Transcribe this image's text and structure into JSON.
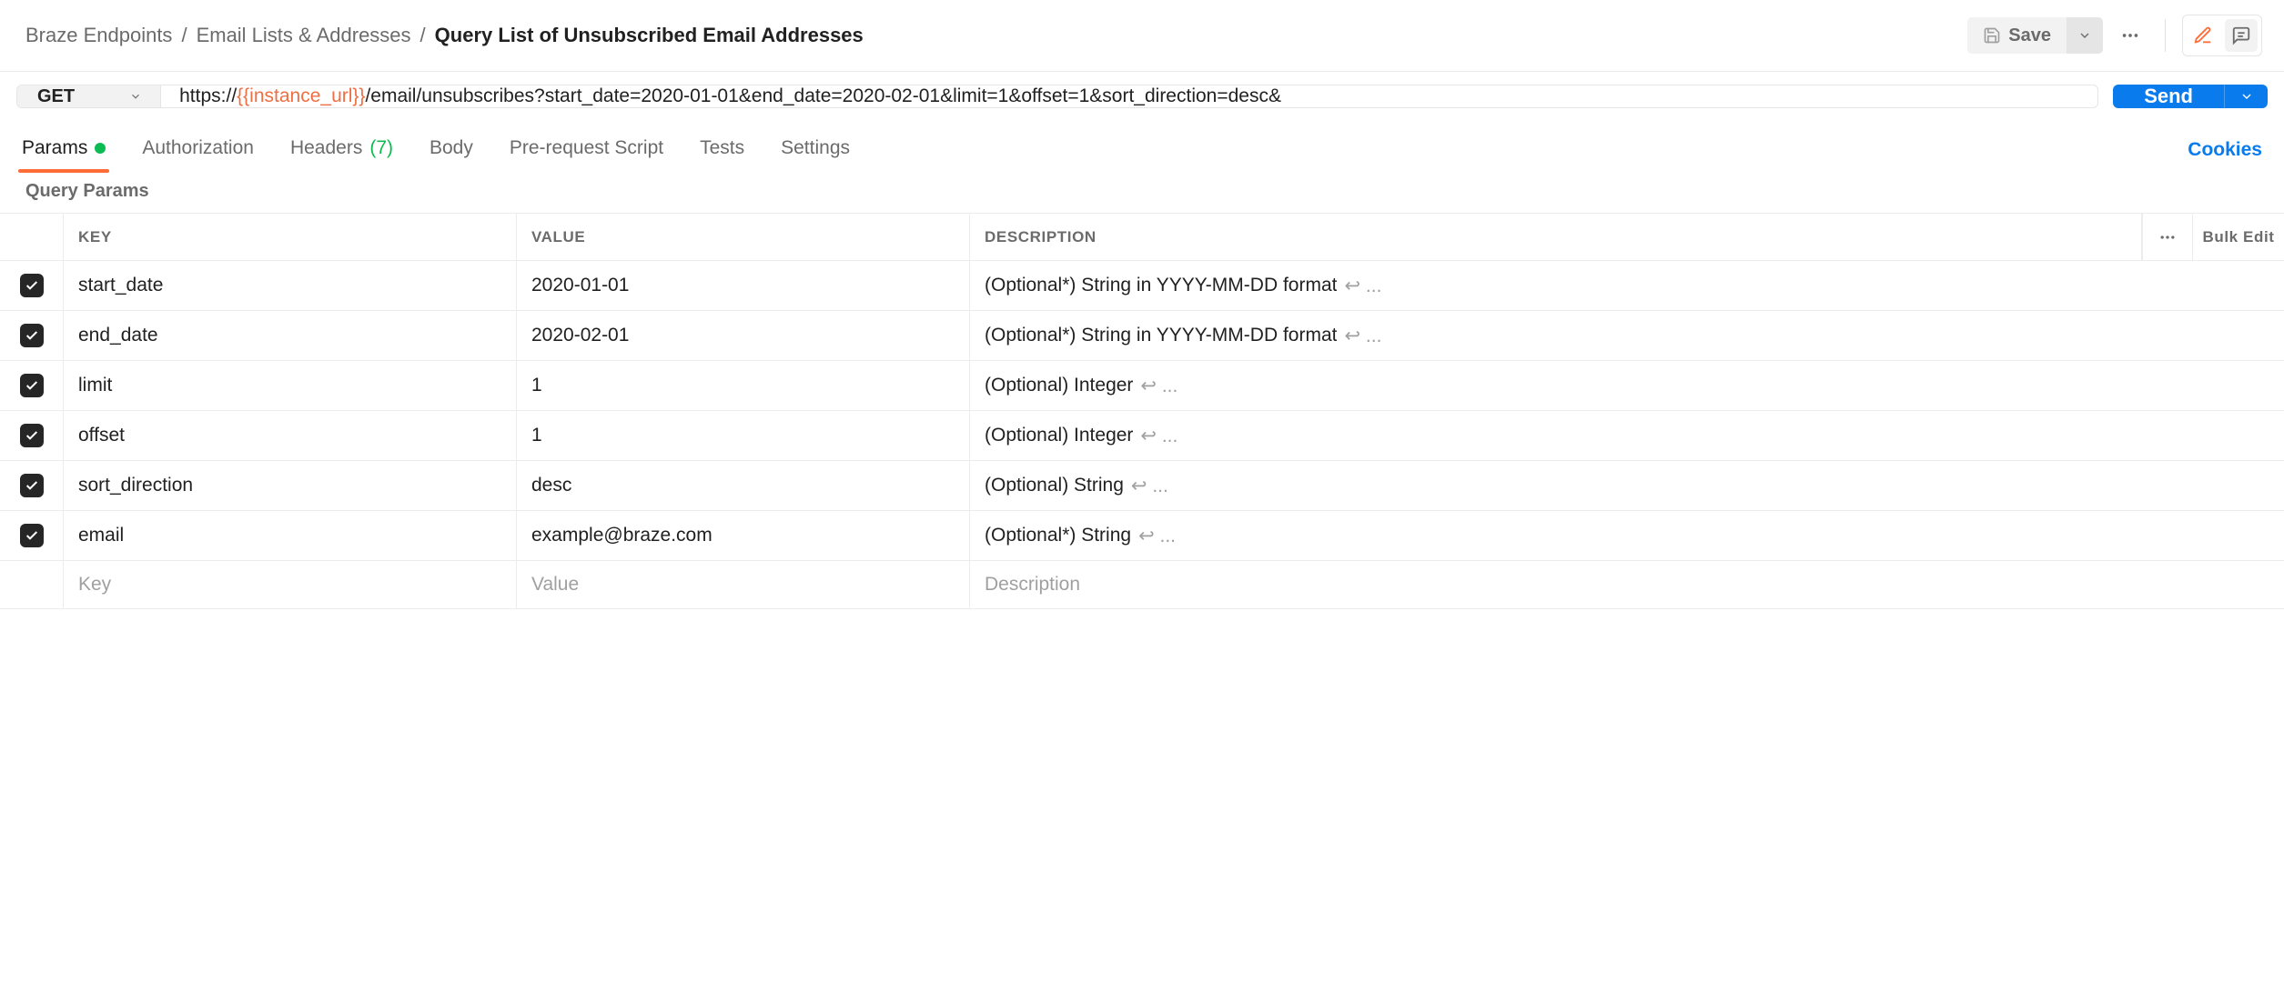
{
  "breadcrumbs": {
    "items": [
      {
        "label": "Braze Endpoints"
      },
      {
        "label": "Email Lists & Addresses"
      }
    ],
    "current": "Query List of Unsubscribed Email Addresses"
  },
  "toolbar": {
    "save_label": "Save"
  },
  "request": {
    "method": "GET",
    "url_prefix": "https://",
    "url_var": "{{instance_url}}",
    "url_suffix": "/email/unsubscribes?start_date=2020-01-01&end_date=2020-02-01&limit=1&offset=1&sort_direction=desc&",
    "send_label": "Send"
  },
  "tabs": [
    {
      "label": "Params",
      "active": true,
      "indicator": "dot"
    },
    {
      "label": "Authorization"
    },
    {
      "label": "Headers",
      "count_label": "(7)"
    },
    {
      "label": "Body"
    },
    {
      "label": "Pre-request Script"
    },
    {
      "label": "Tests"
    },
    {
      "label": "Settings"
    }
  ],
  "cookies_label": "Cookies",
  "section_title": "Query Params",
  "params_table": {
    "headers": {
      "key": "KEY",
      "value": "VALUE",
      "description": "DESCRIPTION",
      "bulk": "Bulk Edit"
    },
    "rows": [
      {
        "enabled": true,
        "key": "start_date",
        "value": "2020-01-01",
        "description": "(Optional*) String in YYYY-MM-DD format",
        "rest": "↩ ..."
      },
      {
        "enabled": true,
        "key": "end_date",
        "value": "2020-02-01",
        "description": "(Optional*)  String in YYYY-MM-DD format",
        "rest": "↩ ..."
      },
      {
        "enabled": true,
        "key": "limit",
        "value": "1",
        "description": "(Optional) Integer",
        "rest": "↩ ..."
      },
      {
        "enabled": true,
        "key": "offset",
        "value": "1",
        "description": "(Optional) Integer",
        "rest": "↩ ..."
      },
      {
        "enabled": true,
        "key": "sort_direction",
        "value": "desc",
        "description": "(Optional) String",
        "rest": "↩ ..."
      },
      {
        "enabled": true,
        "key": "email",
        "value": "example@braze.com",
        "description": "(Optional*) String",
        "rest": "↩ ..."
      }
    ],
    "placeholder_row": {
      "key": "Key",
      "value": "Value",
      "description": "Description"
    }
  }
}
